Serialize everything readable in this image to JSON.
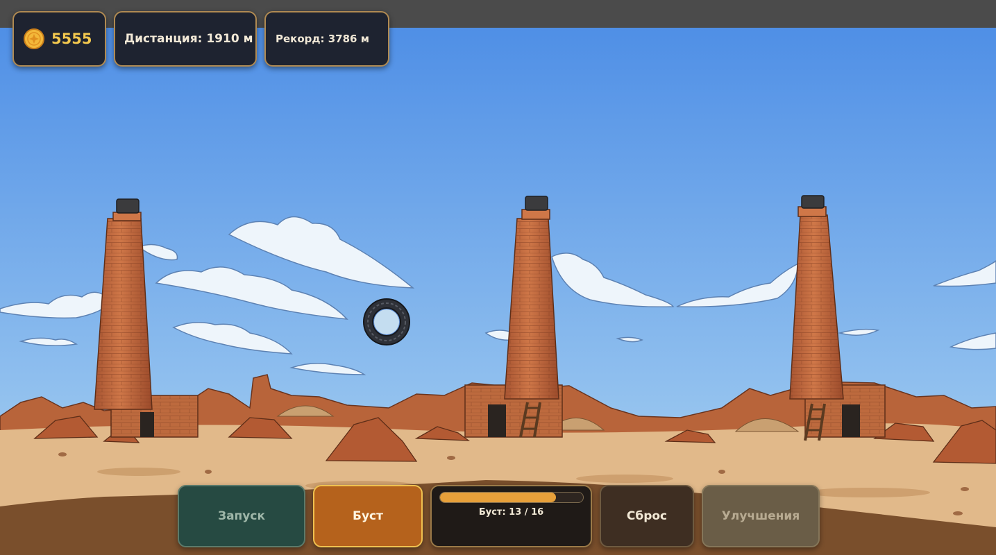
{
  "hud": {
    "coins": "5555",
    "distance": "Дистанция: 1910 м",
    "record": "Рекорд: 3786 м"
  },
  "controls": {
    "launch_label": "Запуск",
    "boost_label": "Буст",
    "boost_status": "Буст: 13 / 16",
    "boost_current": 13,
    "boost_max": 16,
    "reset_label": "Сброс",
    "upgrades_label": "Улучшения"
  },
  "icons": {
    "coin": "coin-icon",
    "player": "tire-icon"
  },
  "colors": {
    "sky_top": "#4f8fe6",
    "sky_bottom": "#aed6f2",
    "ground": "#e1b98a",
    "brick": "#c1693c",
    "coin": "#f3c84e",
    "boost_fill": "#e7a03a"
  }
}
